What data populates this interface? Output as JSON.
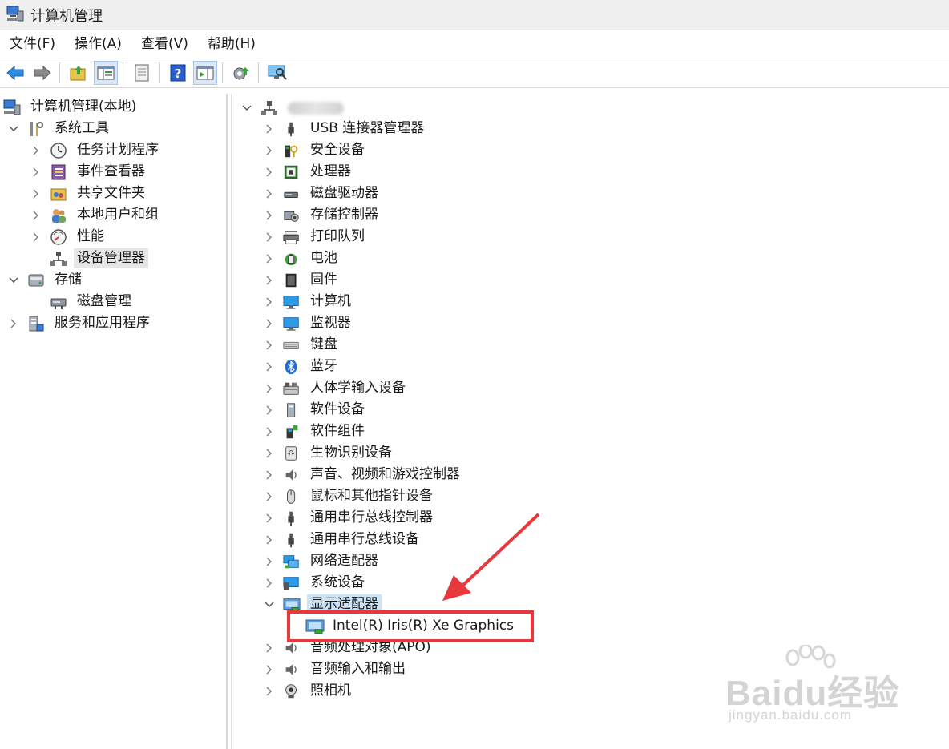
{
  "window": {
    "title": "计算机管理"
  },
  "menu": [
    "文件(F)",
    "操作(A)",
    "查看(V)",
    "帮助(H)"
  ],
  "toolbar": {
    "buttons": [
      {
        "name": "back-icon"
      },
      {
        "name": "forward-icon"
      },
      {
        "name": "up-folder-icon"
      },
      {
        "name": "show-hide-tree-icon"
      },
      {
        "name": "properties-icon"
      },
      {
        "name": "help-icon"
      },
      {
        "name": "action-pane-icon"
      },
      {
        "name": "update-driver-icon"
      },
      {
        "name": "scan-hardware-icon"
      }
    ]
  },
  "left_tree": {
    "root": "计算机管理(本地)",
    "system_tools": "系统工具",
    "task_scheduler": "任务计划程序",
    "event_viewer": "事件查看器",
    "shared_folders": "共享文件夹",
    "local_users": "本地用户和组",
    "performance": "性能",
    "device_manager": "设备管理器",
    "storage": "存储",
    "disk_management": "磁盘管理",
    "services_apps": "服务和应用程序"
  },
  "device_tree": {
    "categories": [
      "USB 连接器管理器",
      "安全设备",
      "处理器",
      "磁盘驱动器",
      "存储控制器",
      "打印队列",
      "电池",
      "固件",
      "计算机",
      "监视器",
      "键盘",
      "蓝牙",
      "人体学输入设备",
      "软件设备",
      "软件组件",
      "生物识别设备",
      "声音、视频和游戏控制器",
      "鼠标和其他指针设备",
      "通用串行总线控制器",
      "通用串行总线设备",
      "网络适配器",
      "系统设备",
      "显示适配器"
    ],
    "display_child": "Intel(R) Iris(R) Xe Graphics",
    "after": [
      "音频处理对象(APO)",
      "音频输入和输出",
      "照相机"
    ]
  },
  "watermark": {
    "brand": "Baidu经验",
    "url": "jingyan.baidu.com"
  },
  "colors": {
    "accent": "#1e7fd8",
    "annotation": "#e8383c",
    "selection": "#cce4f7"
  }
}
